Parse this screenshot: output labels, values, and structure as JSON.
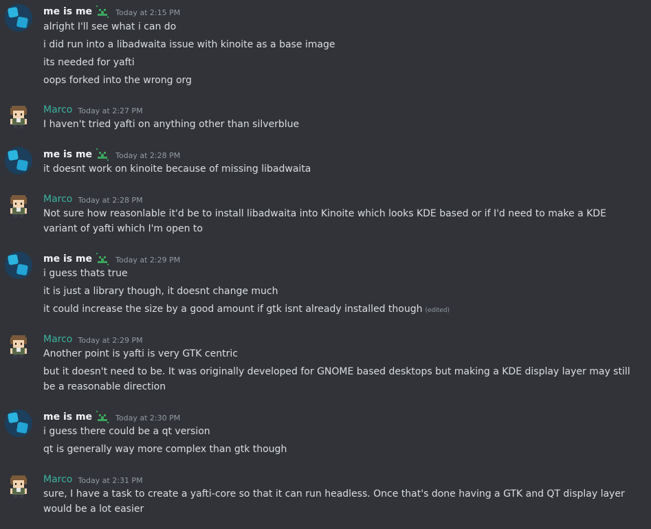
{
  "users": {
    "me": "me is me",
    "marco": "Marco"
  },
  "groups": [
    {
      "author": "me is me",
      "time": "Today at 2:15 PM",
      "messages": [
        "alright I'll see what i can do",
        "i did run into a libadwaita issue with kinoite as a base image",
        "its needed for yafti",
        "oops forked into the wrong org"
      ]
    },
    {
      "author": "Marco",
      "time": "Today at 2:27 PM",
      "messages": [
        "I haven't tried yafti on anything other than silverblue"
      ]
    },
    {
      "author": "me is me",
      "time": "Today at 2:28 PM",
      "messages": [
        "it doesnt work on kinoite because of missing libadwaita"
      ]
    },
    {
      "author": "Marco",
      "time": "Today at 2:28 PM",
      "messages": [
        "Not sure how reasonlable it'd be to install libadwaita into Kinoite which looks KDE based or if I'd need to make a KDE variant of yafti which I'm open to"
      ]
    },
    {
      "author": "me is me",
      "time": "Today at 2:29 PM",
      "messages": [
        "i guess thats true",
        "it is just a library though, it doesnt change much",
        "it could increase the size by a good amount if gtk isnt already installed though"
      ],
      "edited_label": "(edited)"
    },
    {
      "author": "Marco",
      "time": "Today at 2:29 PM",
      "messages": [
        "Another point is yafti is very GTK centric",
        "but it doesn't need to be. It was originally developed for GNOME based desktops but making a KDE display layer may still be a reasonable direction"
      ]
    },
    {
      "author": "me is me",
      "time": "Today at 2:30 PM",
      "messages": [
        "i guess there could be a qt version",
        "qt is generally way more complex than gtk though"
      ]
    },
    {
      "author": "Marco",
      "time": "Today at 2:31 PM",
      "messages": [
        "sure, I have a task to create a yafti-core so that it can run headless. Once that's done having a GTK and QT display layer would be a lot easier"
      ]
    }
  ],
  "colors": {
    "background": "#313338",
    "me_username": "#f2f3f5",
    "marco_username": "#3cb39f",
    "text": "#dbdee1",
    "timestamp": "#949ba4",
    "badge_green": "#3ba55c"
  },
  "icons": {
    "me_avatar": "blue-cube-avatar",
    "marco_avatar": "pixel-person-avatar",
    "badge": "green-download-badge-icon"
  }
}
